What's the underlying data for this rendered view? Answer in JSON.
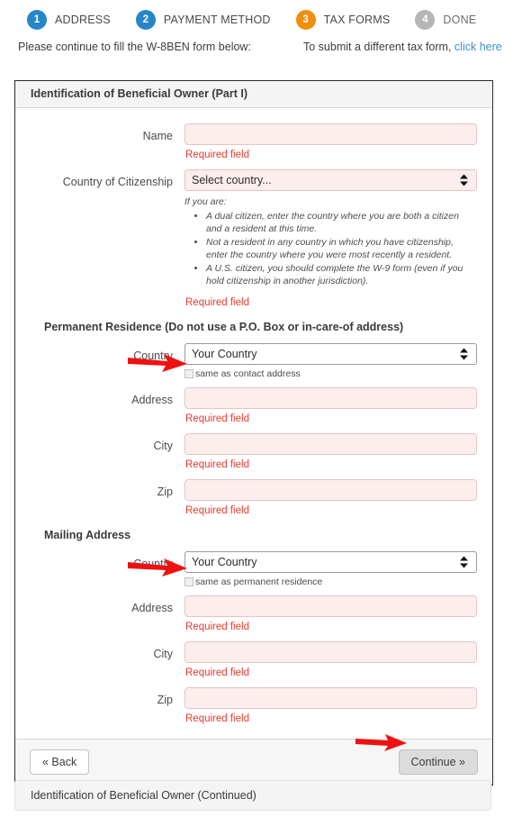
{
  "stepper": {
    "steps": [
      {
        "num": "1",
        "label": "ADDRESS",
        "color": "#2786c9",
        "state": "done"
      },
      {
        "num": "2",
        "label": "PAYMENT METHOD",
        "color": "#2786c9",
        "state": "done"
      },
      {
        "num": "3",
        "label": "TAX FORMS",
        "color": "#ef8f0c",
        "state": "active"
      },
      {
        "num": "4",
        "label": "DONE",
        "color": "#b5b5b5",
        "state": "pending"
      }
    ]
  },
  "intro": {
    "left_text": "Please continue to fill the W-8BEN form below:",
    "right_text": "To submit a different tax form,",
    "right_link": "click here"
  },
  "panel": {
    "title": "Identification of Beneficial Owner (Part I)",
    "name": {
      "label": "Name",
      "value": "",
      "error": "Required field"
    },
    "citizenship": {
      "label": "Country of Citizenship",
      "selected": "Select country...",
      "error": "Required field",
      "hint_intro": "If you are:",
      "hint_items": [
        "A dual citizen, enter the country where you are both a citizen and a resident at this time.",
        "Not a resident in any country in which you have citizenship, enter the country where you were most recently a resident.",
        "A U.S. citizen, you should complete the W-9 form (even if you hold citizenship in another jurisdiction)."
      ]
    },
    "permanent_residence": {
      "section_title": "Permanent Residence (Do not use a P.O. Box or in-care-of address)",
      "country_label": "Country",
      "country_selected": "Your Country",
      "checkbox_label": "same as contact address",
      "checkbox_checked": false,
      "address_label": "Address",
      "address_value": "",
      "address_error": "Required field",
      "city_label": "City",
      "city_value": "",
      "city_error": "Required field",
      "zip_label": "Zip",
      "zip_value": "",
      "zip_error": "Required field"
    },
    "mailing_address": {
      "section_title": "Mailing Address",
      "country_label": "Country",
      "country_selected": "Your Country",
      "checkbox_label": "same as permanent residence",
      "checkbox_checked": false,
      "address_label": "Address",
      "address_value": "",
      "address_error": "Required field",
      "city_label": "City",
      "city_value": "",
      "city_error": "Required field",
      "zip_label": "Zip",
      "zip_value": "",
      "zip_error": "Required field"
    },
    "footer": {
      "back_label": "« Back",
      "continue_label": "Continue »"
    }
  },
  "panel_continued": {
    "title": "Identification of Beneficial Owner (Continued)"
  },
  "annotations": {
    "arrow_color": "#ee1111",
    "arrows": [
      {
        "name": "arrow-to-same-as-contact-address"
      },
      {
        "name": "arrow-to-same-as-permanent-residence"
      },
      {
        "name": "arrow-to-continue-button"
      }
    ]
  }
}
